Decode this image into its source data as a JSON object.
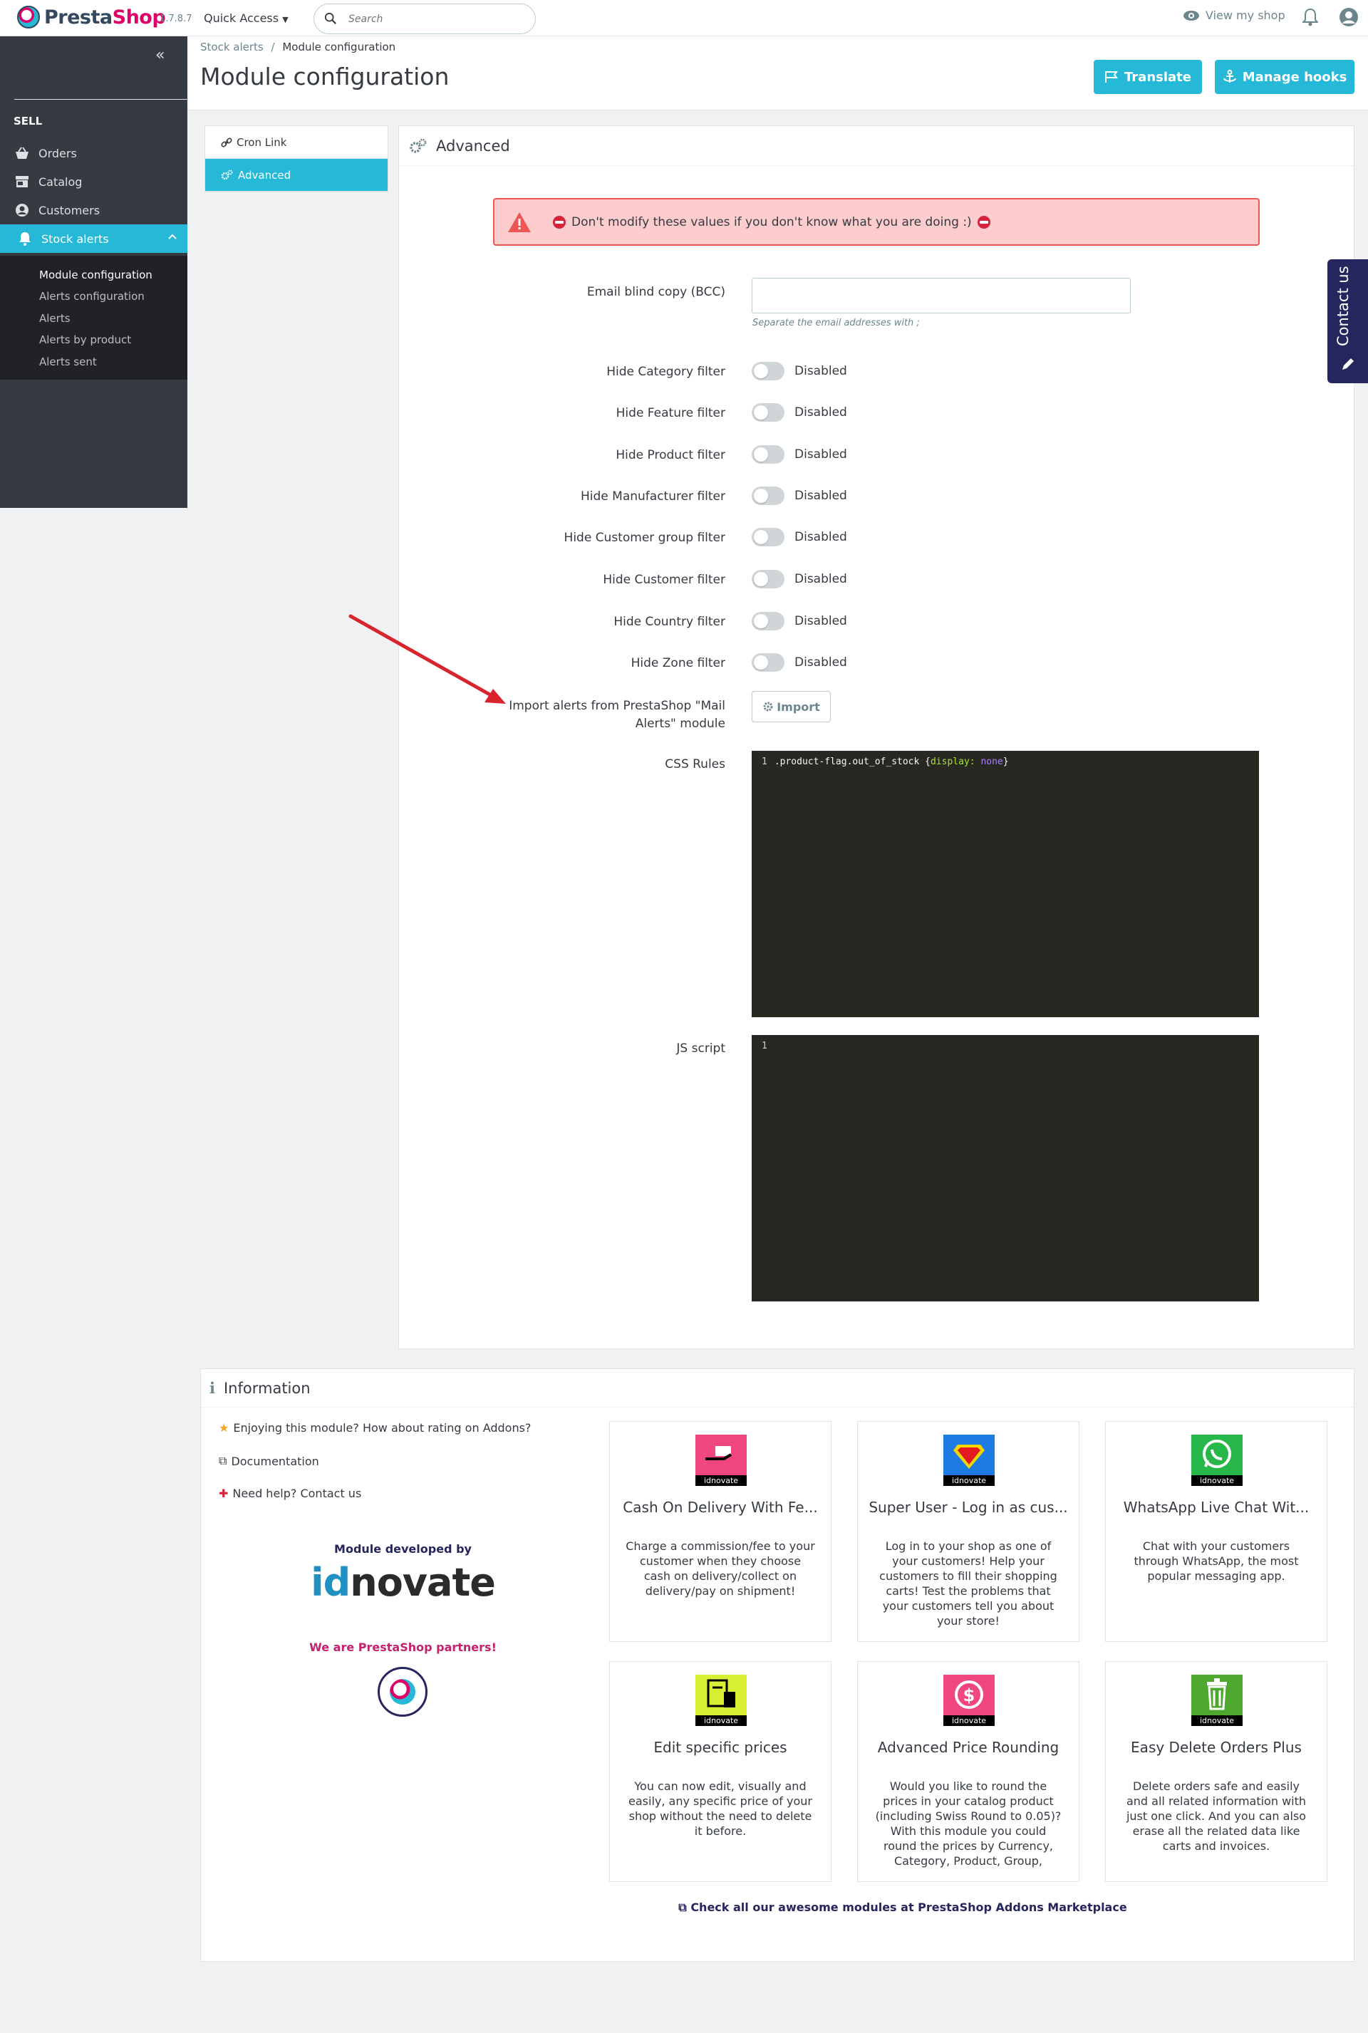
{
  "header": {
    "logo_text_a": "Presta",
    "logo_text_b": "Shop",
    "version": "1.7.8.7",
    "quick_access": "Quick Access",
    "search_placeholder": "Search",
    "view_shop": "View my shop"
  },
  "sidebar": {
    "section": "SELL",
    "items": [
      {
        "label": "Orders",
        "icon": "shopping-basket-icon"
      },
      {
        "label": "Catalog",
        "icon": "store-icon"
      },
      {
        "label": "Customers",
        "icon": "account-circle-icon"
      },
      {
        "label": "Stock alerts",
        "icon": "bell-alert-icon",
        "active": true
      }
    ],
    "submenu": [
      {
        "label": "Module configuration",
        "current": true
      },
      {
        "label": "Alerts configuration"
      },
      {
        "label": "Alerts"
      },
      {
        "label": "Alerts by product"
      },
      {
        "label": "Alerts sent"
      }
    ]
  },
  "page": {
    "breadcrumb_parent": "Stock alerts",
    "breadcrumb_sep": "/",
    "breadcrumb_current": "Module configuration",
    "title": "Module configuration",
    "translate_btn": "Translate",
    "hooks_btn": "Manage hooks"
  },
  "tabs": [
    {
      "label": "Cron Link",
      "icon": "link-icon"
    },
    {
      "label": "Advanced",
      "icon": "cogs-icon",
      "active": true
    }
  ],
  "advanced": {
    "title": "Advanced",
    "warning": "Don't modify these values if you don't know what you are doing :)",
    "email_label": "Email blind copy (BCC)",
    "email_value": "",
    "email_help": "Separate the email addresses with ;",
    "switches": [
      {
        "label": "Hide Category filter",
        "state": "Disabled"
      },
      {
        "label": "Hide Feature filter",
        "state": "Disabled"
      },
      {
        "label": "Hide Product filter",
        "state": "Disabled"
      },
      {
        "label": "Hide Manufacturer filter",
        "state": "Disabled"
      },
      {
        "label": "Hide Customer group filter",
        "state": "Disabled"
      },
      {
        "label": "Hide Customer filter",
        "state": "Disabled"
      },
      {
        "label": "Hide Country filter",
        "state": "Disabled"
      },
      {
        "label": "Hide Zone filter",
        "state": "Disabled"
      }
    ],
    "import_label_1": "Import alerts from PrestaShop \"Mail",
    "import_label_2": "Alerts\" module",
    "import_btn": "Import",
    "css_label": "CSS Rules",
    "css_line_no": "1",
    "css_selector": ".product-flag.out_of_stock {",
    "css_prop": "display:",
    "css_val": "none",
    "css_close": "}",
    "js_label": "JS script",
    "js_line_no": "1"
  },
  "contact_tab": "Contact us",
  "info": {
    "title": "Information",
    "rate": "Enjoying this module? How about rating on Addons?",
    "docs": "Documentation",
    "help": "Need help? Contact us",
    "developed_by": "Module developed by",
    "dev_logo_a": "id",
    "dev_logo_b": "novate",
    "partners": "We are PrestaShop partners!",
    "addons_link": "Check all our awesome modules at PrestaShop Addons Marketplace",
    "modules": [
      {
        "title": "Cash On Delivery With Fe...",
        "desc": "Charge a commission/fee to your customer when they choose cash on delivery/collect on delivery/pay on shipment!",
        "color": "#f0487e",
        "icon": "cash-hand-icon"
      },
      {
        "title": "Super User - Log in as cus...",
        "desc": "Log in to your shop as one of your customers! Help your customers to fill their shopping carts! Test the problems that your customers tell you about your store!",
        "color": "#1d7be3",
        "icon": "superhero-icon"
      },
      {
        "title": "WhatsApp Live Chat Wit...",
        "desc": "Chat with your customers through WhatsApp, the most popular messaging app.",
        "color": "#28b84a",
        "icon": "whatsapp-icon"
      },
      {
        "title": "Edit specific prices",
        "desc": "You can now edit, visually and easily, any specific price of your shop without the need to delete it before.",
        "color": "#d7ef32",
        "icon": "price-sheet-icon"
      },
      {
        "title": "Advanced Price Rounding",
        "desc": "Would you like to round the prices in your catalog product (including Swiss Round to 0.05)? With this module you could round the prices by Currency, Category, Product, Group,",
        "color": "#f0487e",
        "icon": "dollar-cycle-icon"
      },
      {
        "title": "Easy Delete Orders Plus",
        "desc": "Delete orders safe and easily and all related information with just one click. And you can also erase all the related data like carts and invoices.",
        "color": "#4ea82e",
        "icon": "trash-icon"
      }
    ],
    "brand_label": "idnovate"
  }
}
